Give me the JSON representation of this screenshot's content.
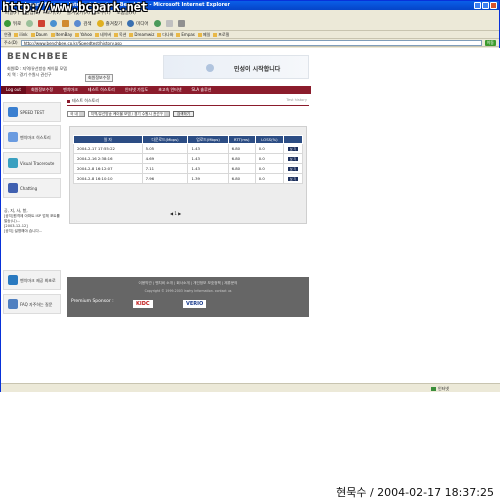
{
  "watermark": "http://www.bcpark.net",
  "window": {
    "title": "Benchmark for your Internet Service - BenchBee - Microsoft Internet Explorer"
  },
  "menubar": [
    "파일(F)",
    "편집(E)",
    "보기(V)",
    "즐겨찾기(A)",
    "도구(T)",
    "도움말(H)"
  ],
  "toolbar": {
    "back": "뒤로",
    "search": "검색",
    "favorites": "즐겨찾기",
    "media": "미디어"
  },
  "linksbar": {
    "label": "연결",
    "links": [
      "ilink",
      "Daum",
      "ItemBay",
      "Yahoo",
      "네이버",
      "옥션",
      "Dreamwiz",
      "다나와",
      "Empas",
      "메일",
      "프로필"
    ]
  },
  "addressbar": {
    "label": "주소(D)",
    "url": "http://www.benchbee.co.kr/Speedtest/history.asp",
    "go": "이동"
  },
  "site": {
    "logo": "BENCHBEE",
    "user_line1": "회원ID : 지역/유선방송 케이블 모뎀",
    "user_line2": "지 역 : 경기 수원시 권선구",
    "info_button": "회원정보수정",
    "banner_text": "민성이 시작합니다"
  },
  "nav": {
    "items": [
      "Log out",
      "회원정보수정",
      "벤치마크",
      "테스트 히스토리",
      "인터넷 가입도",
      "초고속 인터넷",
      "SLA 솔루션"
    ]
  },
  "sidebar": {
    "items": [
      {
        "label": "SPEED TEST",
        "color": "#3a7fd0"
      },
      {
        "label": "벤치마크 히스토리",
        "color": "#6a9be0"
      },
      {
        "label": "Visual Traceroute",
        "color": "#3aa0c0"
      },
      {
        "label": "Chatting",
        "color": "#4060b0"
      },
      {
        "label": "벤치마크 제공 최초로",
        "color": "#2a7ac0"
      },
      {
        "label": "FAQ 자주하는 질문",
        "color": "#5080c0"
      }
    ],
    "notice_title": "공, 지, 사, 항,",
    "notice_lines": [
      "[공지]원격제 아파트 ISP 업체 포트를 발송(니)...",
      "[2003-12-12]",
      "[공지] 설명해야 습니다..."
    ]
  },
  "main": {
    "title": "테스트 히스토리",
    "crumb": "Test history",
    "filter": {
      "select1": "국 내",
      "select2": "지역/유선방송 케이블 모뎀 / 경기 수원시 권선구",
      "button": "검색하기"
    },
    "table": {
      "headers": [
        "일 자",
        "다운로드(Mbps)",
        "업로드(Mbps)",
        "RTT(ms)",
        "LOSS(%)",
        ""
      ],
      "rows": [
        [
          "2004-2-17 17:55:22",
          "5.05",
          "1.43",
          "6.80",
          "0.0",
          "보 기"
        ],
        [
          "2004-2-16 2:38:16",
          "4.69",
          "1.43",
          "6.80",
          "0.0",
          "보 기"
        ],
        [
          "2004-2-8 16:12:07",
          "7.11",
          "1.43",
          "6.80",
          "0.0",
          "보 기"
        ],
        [
          "2004-2-8 16:10:10",
          "7.96",
          "1.39",
          "6.80",
          "0.0",
          "보 기"
        ]
      ]
    },
    "pager": "◀ 1 ▶"
  },
  "footer": {
    "links": "이용약관 | 벤치비 소개 | 회사소개 | 개인정보 보호정책 | 제휴문의",
    "copyright": "Copyright © 1999-2003 Inwhy Information. contact us",
    "sponsor_label": "Premium Sponsor :",
    "sponsors": [
      "KIDC",
      "VERIO"
    ]
  },
  "statusbar": {
    "zone": "인터넷"
  },
  "caption": "현묵수 / 2004-02-17 18:37:25"
}
